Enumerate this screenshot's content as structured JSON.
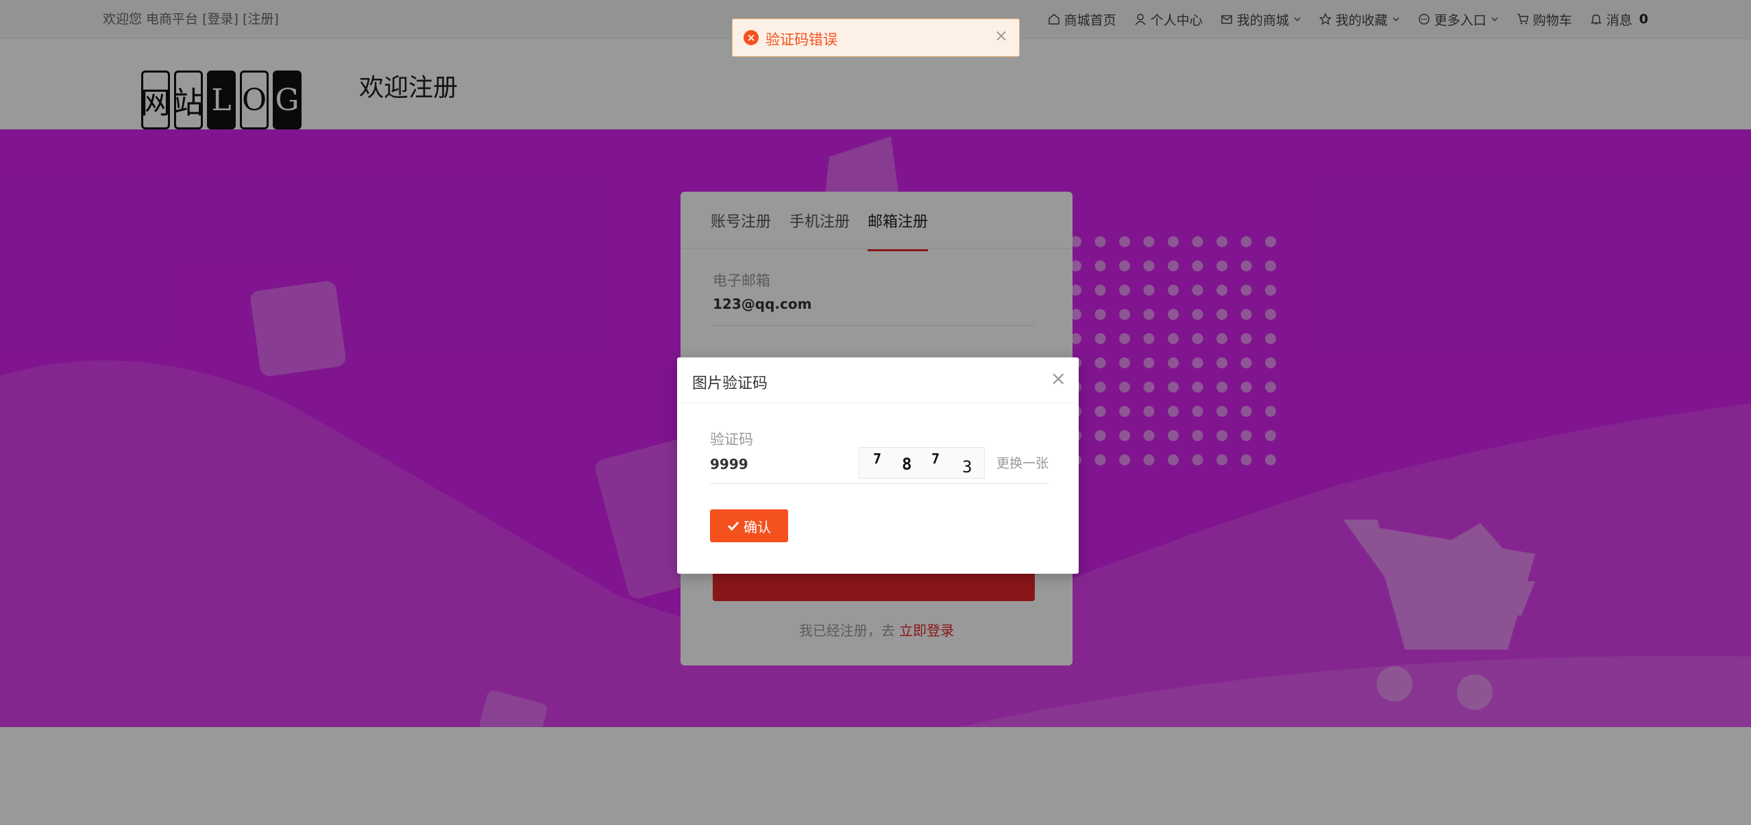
{
  "topbar": {
    "welcome": "欢迎您 电商平台 [登录] [注册]",
    "nav": [
      {
        "label": "商城首页",
        "icon": "home-icon"
      },
      {
        "label": "个人中心",
        "icon": "user-icon"
      },
      {
        "label": "我的商城",
        "icon": "mail-icon"
      },
      {
        "label": "我的收藏",
        "icon": "star-icon"
      },
      {
        "label": "更多入口",
        "icon": "more-icon"
      },
      {
        "label": "购物车",
        "icon": "cart-icon"
      },
      {
        "label": "消息",
        "icon": "bell-icon",
        "count": "0"
      }
    ]
  },
  "header": {
    "title": "欢迎注册",
    "logo_chars": [
      "网",
      "站",
      "L",
      "O",
      "G"
    ]
  },
  "register": {
    "tabs": [
      "账号注册",
      "手机注册",
      "邮箱注册"
    ],
    "active_tab": "邮箱注册",
    "email_label": "电子邮箱",
    "email_value": "123@qq.com",
    "login_prompt": "我已经注册，去",
    "login_link": "立即登录"
  },
  "modal": {
    "title": "图片验证码",
    "code_label": "验证码",
    "code_value": "9999",
    "captcha_chars": [
      "7",
      "8",
      "7",
      "3"
    ],
    "swap_label": "更换一张",
    "confirm_label": "确认"
  },
  "toast": {
    "message": "验证码错误"
  },
  "colors": {
    "accent": "#e5252a",
    "banner": "#d624ee",
    "confirm": "#f4511e",
    "toast_bg": "#fdf0e6"
  }
}
